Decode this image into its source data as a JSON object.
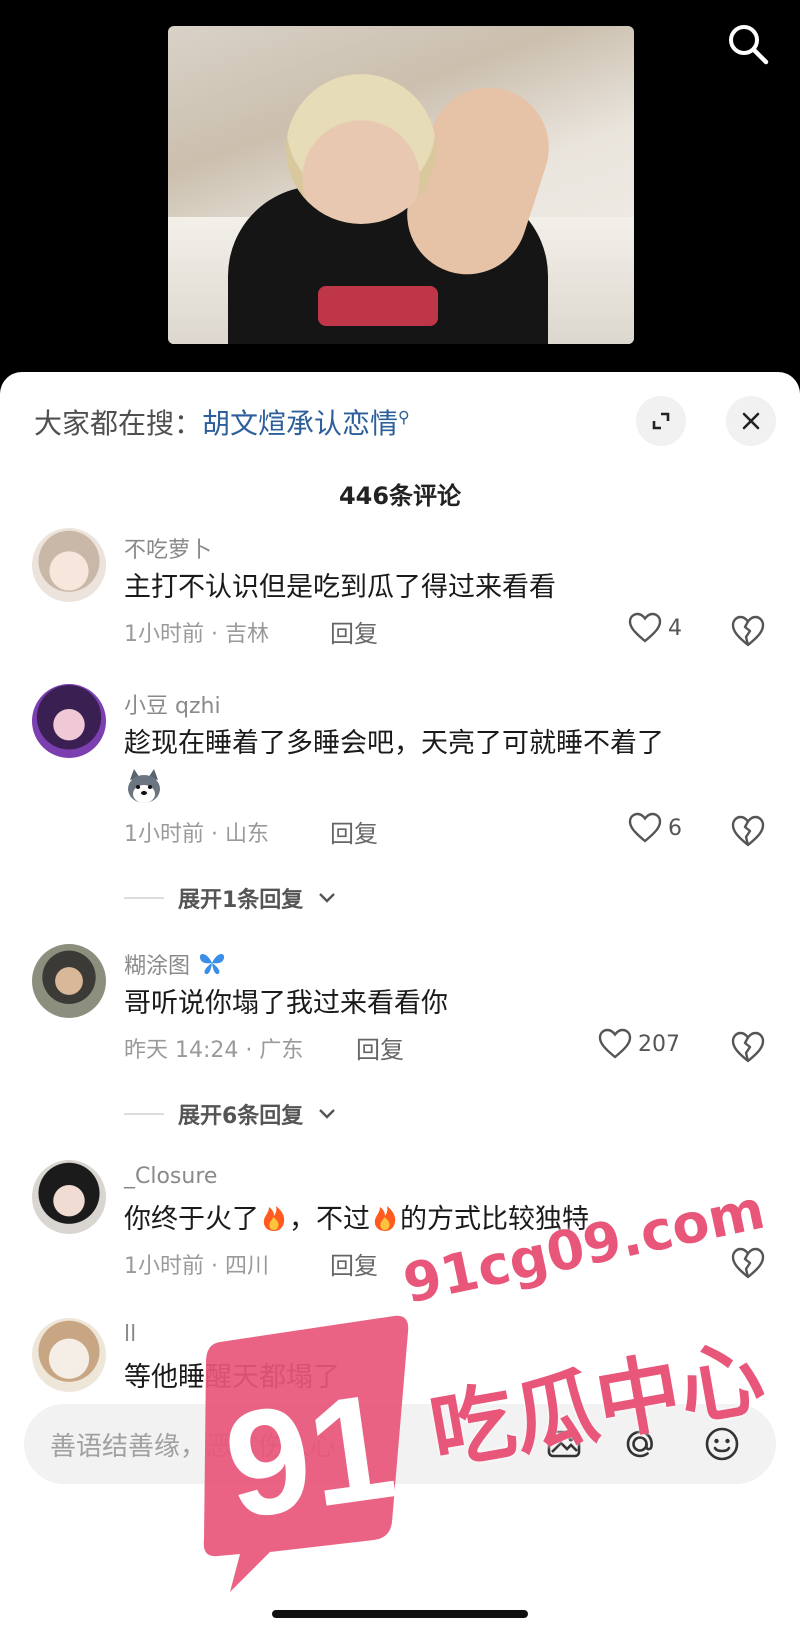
{
  "search_top_icon": "search-icon",
  "trending": {
    "prefix": "大家都在搜：",
    "keyword": "胡文煊承认恋情",
    "icon": "magnifier-small-icon"
  },
  "comment_count": "446条评论",
  "comments": [
    {
      "username": "不吃萝卜",
      "text": "主打不认识但是吃到瓜了得过来看看",
      "time_location": "1小时前 · 吉林",
      "reply_label": "回复",
      "likes": "4"
    },
    {
      "username": "小豆 qzhi",
      "text": "趁现在睡着了多睡会吧，天亮了可就睡不着了",
      "sticker": "husky-sticker",
      "time_location": "1小时前 · 山东",
      "reply_label": "回复",
      "likes": "6",
      "expand_label": "展开1条回复"
    },
    {
      "username": "糊涂图",
      "username_icon": "butterfly-icon",
      "text": "哥听说你塌了我过来看看你",
      "time_location": "昨天 14:24 · 广东",
      "reply_label": "回复",
      "likes": "207",
      "expand_label": "展开6条回复"
    },
    {
      "username": "_Closure",
      "text_part1": "你终于火了",
      "text_part2": "，不过",
      "text_part3": "的方式比较独特",
      "time_location": "1小时前 · 四川",
      "reply_label": "回复",
      "likes": ""
    },
    {
      "username": "ll",
      "text": "等他睡醒天都塌了"
    }
  ],
  "input": {
    "placeholder": "善语结善缘，恶言伤人心",
    "icons": [
      "image-icon",
      "at-icon",
      "emoji-icon"
    ]
  },
  "watermark": {
    "badge": "91",
    "url": "91cg09.com",
    "title": "吃瓜中心"
  },
  "colors": {
    "link": "#2d5f9a",
    "watermark": "#e8567a"
  }
}
